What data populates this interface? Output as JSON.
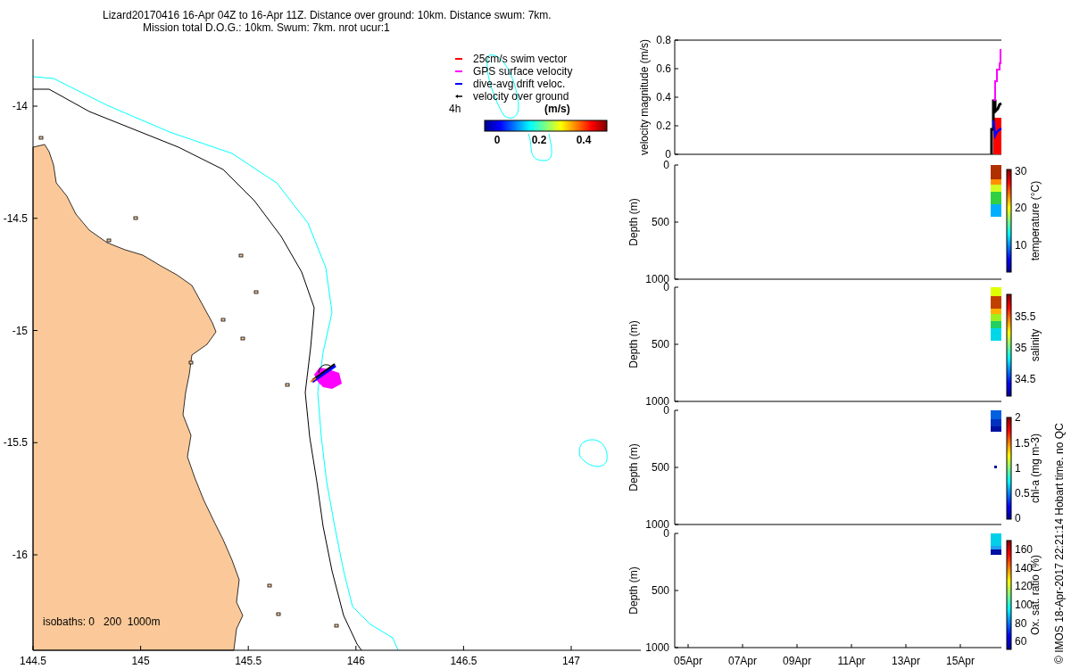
{
  "title": {
    "line_1": "Lizard20170416 16-Apr 04Z to 16-Apr 11Z. Distance over ground: 10km. Distance swum: 7km.",
    "line_2": "Mission total D.O.G.: 10km. Swum: 7km. nrot ucur:1"
  },
  "map": {
    "xticks": [
      "144.5",
      "145",
      "145.5",
      "146",
      "146.5",
      "147"
    ],
    "yticks": [
      "-14",
      "-14.5",
      "-15",
      "-15.5",
      "-16"
    ],
    "legend": [
      {
        "label": "25cm/s swim vector",
        "color": "#ff0000"
      },
      {
        "label": "GPS surface velocity",
        "color": "#ff00ff"
      },
      {
        "label": "dive-avg drift veloc.",
        "color": "#0000ff"
      },
      {
        "label": "velocity over ground",
        "color": "#000000"
      }
    ],
    "legend_interval": "4h",
    "colorbar": {
      "label": "(m/s)",
      "ticks": [
        "0",
        "0.2",
        "0.4"
      ]
    },
    "isobaths_note": "isobaths: 0   200  1000m"
  },
  "velocity_panel": {
    "ylabel": "velocity magnitude (m/s)",
    "yticks": [
      "0.8",
      "0.6",
      "0.4",
      "0.2",
      "0"
    ]
  },
  "depth_panels": [
    {
      "ylabel": "Depth (m)",
      "yticks": [
        "0",
        "500",
        "1000"
      ],
      "colorbar": {
        "label": "temperature (°C)",
        "ticks": [
          "30",
          "20",
          "10"
        ]
      }
    },
    {
      "ylabel": "Depth (m)",
      "yticks": [
        "0",
        "500",
        "1000"
      ],
      "colorbar": {
        "label": "salinity",
        "ticks": [
          "35.5",
          "35",
          "34.5"
        ]
      }
    },
    {
      "ylabel": "Depth (m)",
      "yticks": [
        "0",
        "500",
        "1000"
      ],
      "colorbar": {
        "label": "chl-a (mg m-3)",
        "ticks": [
          "2",
          "1.5",
          "1",
          "0.5",
          "0"
        ]
      }
    },
    {
      "ylabel": "Depth (m)",
      "yticks": [
        "0",
        "500",
        "1000"
      ],
      "colorbar": {
        "label": "Ox. sat. ratio (%)",
        "ticks": [
          "160",
          "140",
          "120",
          "100",
          "80",
          "60"
        ]
      }
    }
  ],
  "time_axis": {
    "ticks": [
      "05Apr",
      "07Apr",
      "09Apr",
      "11Apr",
      "13Apr",
      "15Apr"
    ]
  },
  "credit": "© IMOS 18-Apr-2017 22:21:14 Hobart time. no QC"
}
